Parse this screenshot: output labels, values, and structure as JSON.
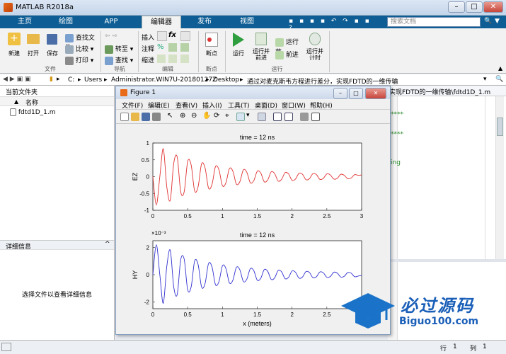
{
  "window": {
    "title": "MATLAB R2018a"
  },
  "tabs": [
    {
      "label": "主页"
    },
    {
      "label": "绘图"
    },
    {
      "label": "APP"
    },
    {
      "label": "编辑器"
    },
    {
      "label": "发布"
    },
    {
      "label": "视图"
    }
  ],
  "search": {
    "placeholder": "搜索文档"
  },
  "ribbon": {
    "file": {
      "new": "新建",
      "open": "打开",
      "save": "保存",
      "find_files": "查找文件",
      "compare": "比较",
      "print": "打印",
      "group": "文件"
    },
    "navigate": {
      "goto": "转至",
      "find": "查找",
      "group": "导航"
    },
    "edit": {
      "insert": "插入",
      "comment": "注释",
      "indent": "缩进",
      "fx": "fx",
      "group": "编辑"
    },
    "breakpoints": {
      "label": "断点",
      "group": "断点"
    },
    "run": {
      "run": "运行",
      "run_advance": "运行并\n前进",
      "run_section": "运行节",
      "advance": "前进",
      "run_time": "运行并\n计时",
      "group": "运行"
    }
  },
  "address": {
    "parts": [
      "C:",
      "Users",
      "Administrator.WIN7U-20180127Z",
      "Desktop",
      "通过对麦克斯韦方程进行差分，实现FDTD的一维传输"
    ]
  },
  "left_panel": {
    "title": "当前文件夹",
    "col_name": "名称",
    "file": "fdtd1D_1.m",
    "details_title": "详细信息",
    "details_hint": "选择文件以查看详细信息"
  },
  "right_panel": {
    "tab": "实现FDTD的一维传输\\fdtd1D_1.m",
    "snippets": [
      "****",
      "****",
      "ing"
    ]
  },
  "figure": {
    "title": "Figure 1",
    "menu": [
      "文件(F)",
      "编辑(E)",
      "查看(V)",
      "插入(I)",
      "工具(T)",
      "桌面(D)",
      "窗口(W)",
      "帮助(H)"
    ]
  },
  "status": {
    "row_label": "行",
    "row": "1",
    "col_label": "列",
    "col": "1"
  },
  "watermark": {
    "text": "必过源码",
    "url": "Biguo100.com"
  },
  "chart_data": [
    {
      "type": "line",
      "title": "time = 12 ns",
      "ylabel": "EZ",
      "xlabel": "",
      "xlim": [
        0,
        3
      ],
      "ylim": [
        -1,
        1
      ],
      "xticks": [
        "0",
        "0.5",
        "1",
        "1.5",
        "2",
        "2.5",
        "3"
      ],
      "yticks": [
        "1",
        "0.5",
        "0",
        "-0.5",
        "-1"
      ],
      "color": "#e03030",
      "series": [
        {
          "x": [
            0.0,
            0.05,
            0.1,
            0.15,
            0.2,
            0.25,
            0.3,
            0.35,
            0.4,
            0.45,
            0.5,
            0.55,
            0.6,
            0.65,
            0.7,
            0.75,
            0.8,
            0.85,
            0.9,
            0.95,
            1.0,
            1.05,
            1.1,
            1.15,
            1.2,
            1.25,
            1.3,
            1.35,
            1.4,
            1.45,
            1.5,
            1.55,
            1.6,
            1.65,
            1.7,
            1.75,
            1.8,
            1.85,
            1.9,
            1.95,
            2.0,
            2.05,
            2.1,
            2.15,
            2.2,
            2.25,
            2.3,
            2.35,
            2.4,
            2.45,
            2.5,
            2.55,
            2.6,
            2.65,
            2.7,
            2.75,
            2.8,
            2.85,
            2.9,
            2.95,
            3.0
          ],
          "y": [
            0.0,
            -0.84,
            0.0,
            0.83,
            -0.3,
            -0.7,
            0.4,
            0.58,
            -0.45,
            -0.45,
            0.45,
            0.35,
            -0.42,
            -0.3,
            0.38,
            0.26,
            -0.34,
            -0.23,
            0.3,
            0.2,
            -0.27,
            -0.18,
            0.24,
            0.16,
            -0.22,
            -0.15,
            0.2,
            0.13,
            -0.18,
            -0.12,
            0.16,
            0.11,
            -0.15,
            -0.1,
            0.14,
            0.09,
            -0.13,
            -0.08,
            0.12,
            0.08,
            -0.11,
            -0.07,
            0.1,
            0.07,
            -0.09,
            -0.06,
            0.09,
            0.06,
            -0.08,
            -0.05,
            0.08,
            0.05,
            -0.07,
            -0.05,
            0.07,
            0.04,
            -0.06,
            -0.04,
            0.06,
            0.04,
            0.05
          ]
        }
      ]
    },
    {
      "type": "line",
      "title": "time = 12 ns",
      "ylabel": "HY",
      "xlabel": "x (meters)",
      "exponent": "×10⁻³",
      "xlim": [
        0,
        3
      ],
      "ylim": [
        -2.5,
        2.5
      ],
      "xticks": [
        "0",
        "0.5",
        "1",
        "1.5",
        "2",
        "2.5"
      ],
      "yticks": [
        "2",
        "0",
        "-2"
      ],
      "color": "#3030d0",
      "series": [
        {
          "x": [
            0.0,
            0.05,
            0.1,
            0.15,
            0.2,
            0.25,
            0.3,
            0.35,
            0.4,
            0.45,
            0.5,
            0.55,
            0.6,
            0.65,
            0.7,
            0.75,
            0.8,
            0.85,
            0.9,
            0.95,
            1.0,
            1.05,
            1.1,
            1.15,
            1.2,
            1.25,
            1.3,
            1.35,
            1.4,
            1.45,
            1.5,
            1.55,
            1.6,
            1.65,
            1.7,
            1.75,
            1.8,
            1.85,
            1.9,
            1.95,
            2.0,
            2.05,
            2.1,
            2.15,
            2.2,
            2.25,
            2.3,
            2.35,
            2.4,
            2.45,
            2.5,
            2.55,
            2.6,
            2.65,
            2.7,
            2.75,
            2.8,
            2.85,
            2.9,
            2.95,
            3.0
          ],
          "y": [
            0.0,
            2.2,
            0.0,
            -2.1,
            0.6,
            1.8,
            -0.9,
            -1.45,
            1.1,
            1.15,
            -1.1,
            -0.9,
            1.0,
            0.75,
            -0.9,
            -0.65,
            0.82,
            0.57,
            -0.73,
            -0.5,
            0.66,
            0.45,
            -0.6,
            -0.4,
            0.54,
            0.36,
            -0.49,
            -0.33,
            0.44,
            0.3,
            -0.4,
            -0.27,
            0.37,
            0.25,
            -0.34,
            -0.23,
            0.31,
            0.21,
            -0.29,
            -0.19,
            0.27,
            0.18,
            -0.25,
            -0.17,
            0.23,
            0.16,
            -0.22,
            -0.15,
            0.2,
            0.14,
            -0.19,
            -0.13,
            0.18,
            0.12,
            -0.17,
            -0.12,
            0.16,
            0.11,
            -0.15,
            -0.1,
            -0.05
          ]
        }
      ]
    }
  ]
}
